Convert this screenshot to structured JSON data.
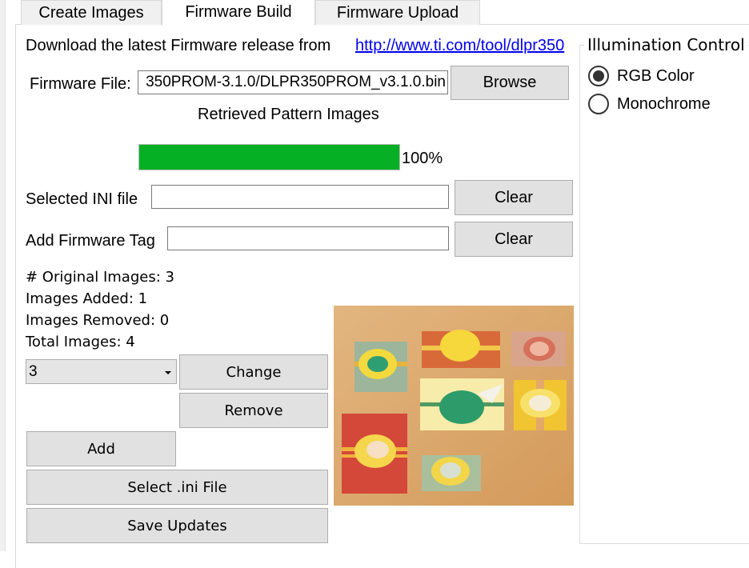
{
  "tabs": [
    {
      "label": "Create Images",
      "active": false
    },
    {
      "label": "Firmware Build",
      "active": true
    },
    {
      "label": "Firmware Upload",
      "active": false
    }
  ],
  "download": {
    "text": "Download the latest Firmware release from",
    "link": "http://www.ti.com/tool/dlpr350"
  },
  "firmware_file": {
    "label": "Firmware File:",
    "value": "350PROM-3.1.0/DLPR350PROM_v3.1.0.bin",
    "browse_label": "Browse"
  },
  "retrieved": {
    "label": "Retrieved Pattern Images",
    "progress_percent": 100,
    "progress_text": "100%"
  },
  "ini_file": {
    "label": "Selected INI file",
    "value": "",
    "clear_label": "Clear"
  },
  "firmware_tag": {
    "label": "Add Firmware Tag",
    "value": "",
    "clear_label": "Clear"
  },
  "stats": {
    "original": "# Original Images: 3",
    "added": "Images Added: 1",
    "removed": "Images Removed: 0",
    "total": "Total Images: 4"
  },
  "image_select": {
    "selected": "3"
  },
  "buttons": {
    "change": "Change",
    "remove": "Remove",
    "add": "Add",
    "select_ini": "Select .ini File",
    "save_updates": "Save Updates"
  },
  "illumination": {
    "title": "Illumination Control",
    "options": [
      {
        "label": "RGB Color",
        "checked": true
      },
      {
        "label": "Monochrome",
        "checked": false
      }
    ]
  },
  "preview": {
    "description": "gift boxes with paper flowers"
  }
}
